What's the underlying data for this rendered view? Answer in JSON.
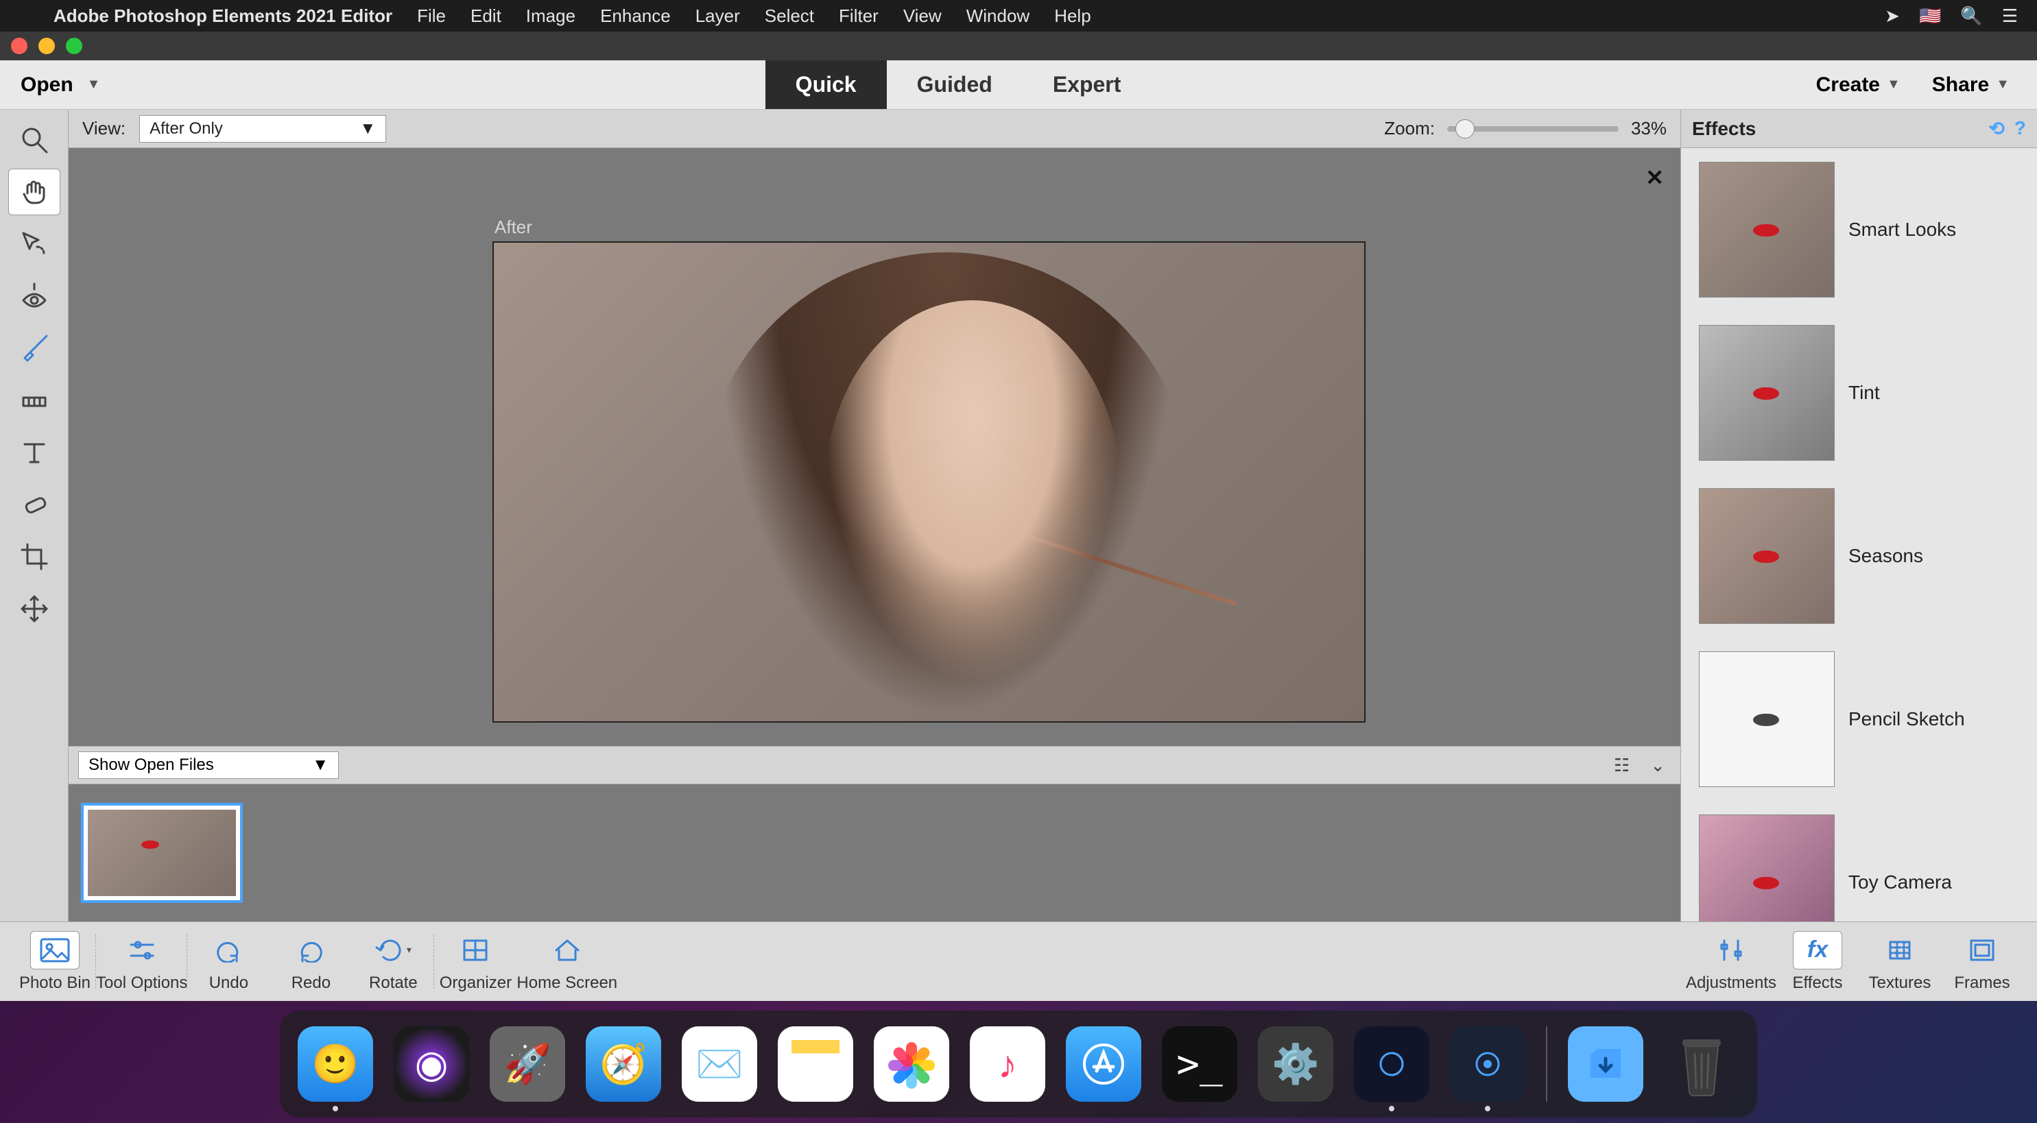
{
  "mac_menu": {
    "app_name": "Adobe Photoshop Elements 2021 Editor",
    "items": [
      "File",
      "Edit",
      "Image",
      "Enhance",
      "Layer",
      "Select",
      "Filter",
      "View",
      "Window",
      "Help"
    ]
  },
  "appbar": {
    "open_label": "Open",
    "modes": {
      "quick": "Quick",
      "guided": "Guided",
      "expert": "Expert",
      "active": "quick"
    },
    "create_label": "Create",
    "share_label": "Share"
  },
  "tools": [
    {
      "name": "zoom-tool-icon"
    },
    {
      "name": "hand-tool-icon",
      "active": true
    },
    {
      "name": "quick-select-tool-icon"
    },
    {
      "name": "redeye-tool-icon"
    },
    {
      "name": "whiten-teeth-tool-icon"
    },
    {
      "name": "straighten-tool-icon"
    },
    {
      "name": "type-tool-icon"
    },
    {
      "name": "spot-heal-tool-icon"
    },
    {
      "name": "crop-tool-icon"
    },
    {
      "name": "move-tool-icon"
    }
  ],
  "center": {
    "view_label": "View:",
    "view_value": "After Only",
    "zoom_label": "Zoom:",
    "zoom_value": "33%",
    "after_label": "After",
    "photo_bin_selector": "Show Open Files"
  },
  "effects_panel": {
    "title": "Effects",
    "items": [
      {
        "label": "Smart Looks",
        "style": "color"
      },
      {
        "label": "Tint",
        "style": "tint"
      },
      {
        "label": "Seasons",
        "style": "color"
      },
      {
        "label": "Pencil Sketch",
        "style": "pencil"
      },
      {
        "label": "Toy Camera",
        "style": "toy"
      }
    ]
  },
  "bottombar": {
    "left": [
      {
        "key": "photo-bin",
        "label": "Photo Bin",
        "icon": "image-icon",
        "active": true
      },
      {
        "key": "tool-options",
        "label": "Tool Options",
        "icon": "sliders-icon"
      },
      {
        "key": "undo",
        "label": "Undo",
        "icon": "undo-icon"
      },
      {
        "key": "redo",
        "label": "Redo",
        "icon": "redo-icon"
      },
      {
        "key": "rotate",
        "label": "Rotate",
        "icon": "rotate-icon"
      },
      {
        "key": "organizer",
        "label": "Organizer",
        "icon": "grid-icon"
      },
      {
        "key": "home-screen",
        "label": "Home Screen",
        "icon": "home-icon"
      }
    ],
    "right": [
      {
        "key": "adjustments",
        "label": "Adjustments",
        "icon": "adjust-icon"
      },
      {
        "key": "effects",
        "label": "Effects",
        "icon": "fx-icon",
        "active": true
      },
      {
        "key": "textures",
        "label": "Textures",
        "icon": "texture-icon"
      },
      {
        "key": "frames",
        "label": "Frames",
        "icon": "frame-icon"
      }
    ]
  },
  "dock": {
    "items": [
      {
        "name": "finder",
        "running": true
      },
      {
        "name": "siri"
      },
      {
        "name": "launchpad"
      },
      {
        "name": "safari"
      },
      {
        "name": "mail"
      },
      {
        "name": "notes"
      },
      {
        "name": "photos"
      },
      {
        "name": "music"
      },
      {
        "name": "app-store"
      },
      {
        "name": "terminal"
      },
      {
        "name": "system-preferences"
      },
      {
        "name": "pse-organizer",
        "running": true
      },
      {
        "name": "pse-editor",
        "running": true
      }
    ],
    "right": [
      {
        "name": "downloads-stack"
      },
      {
        "name": "trash"
      }
    ]
  }
}
